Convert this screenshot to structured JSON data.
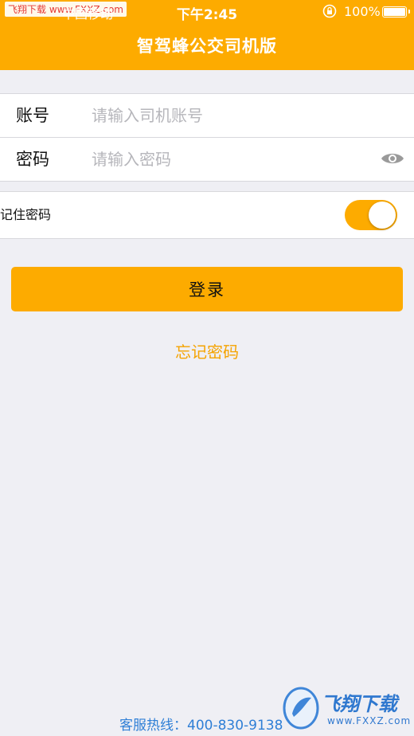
{
  "status_bar": {
    "carrier_badge": "飞翔下载 www.FXXZ.com",
    "carrier": "中国移动",
    "time": "下午2:45",
    "battery": "100%"
  },
  "header": {
    "title": "智驾蜂公交司机版"
  },
  "form": {
    "account_label": "账号",
    "account_placeholder": "请输入司机账号",
    "password_label": "密码",
    "password_placeholder": "请输入密码",
    "remember_label": "记住密码",
    "remember_on": true
  },
  "login_label": "登录",
  "forgot_label": "忘记密码",
  "hotline": "客服热线：400-830-9138",
  "watermark": {
    "text": "飞翔下载",
    "url": "www.FXXZ.com"
  },
  "colors": {
    "accent": "#fdab00",
    "link": "#f5a300",
    "hotline": "#2f7fd6"
  }
}
